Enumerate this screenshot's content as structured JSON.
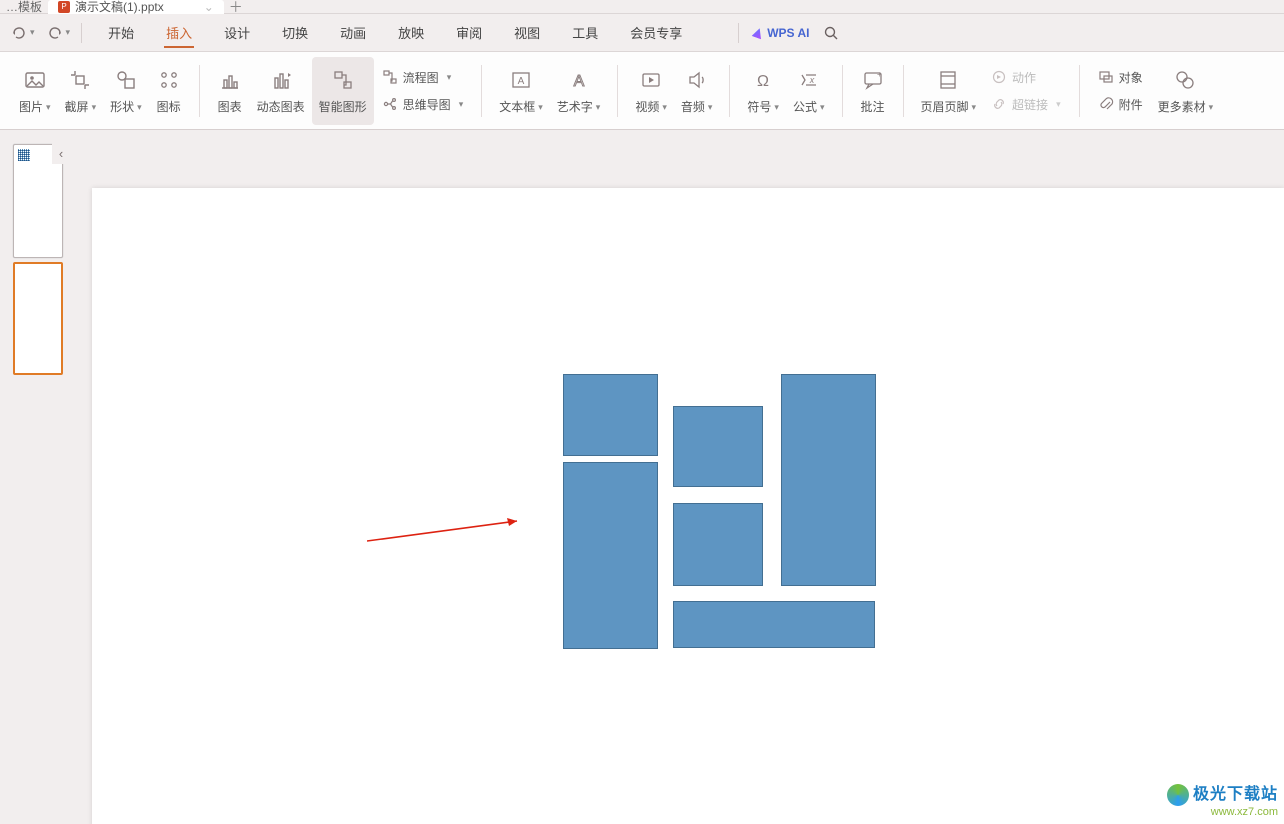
{
  "file": {
    "tab_truncated": "…模板",
    "name": "演示文稿(1).pptx"
  },
  "quick": {
    "undo_tip": "撤销",
    "redo_tip": "重做"
  },
  "menu": {
    "start": "开始",
    "insert": "插入",
    "design": "设计",
    "transition": "切换",
    "animation": "动画",
    "slideshow": "放映",
    "review": "审阅",
    "view": "视图",
    "tools": "工具",
    "member": "会员专享",
    "ai": "WPS AI"
  },
  "ribbon": {
    "picture": "图片",
    "screenshot": "截屏",
    "shapes": "形状",
    "icons": "图标",
    "chart": "图表",
    "dynamic_chart": "动态图表",
    "smart_shape": "智能图形",
    "flowchart": "流程图",
    "mindmap": "思维导图",
    "textbox": "文本框",
    "wordart": "艺术字",
    "video": "视频",
    "audio": "音频",
    "symbol": "符号",
    "equation": "公式",
    "comment": "批注",
    "header_footer": "页眉页脚",
    "action": "动作",
    "hyperlink": "超链接",
    "object": "对象",
    "attachment": "附件",
    "more": "更多素材"
  },
  "watermark": {
    "brand": "极光下载站",
    "url": "www.xz7.com"
  }
}
